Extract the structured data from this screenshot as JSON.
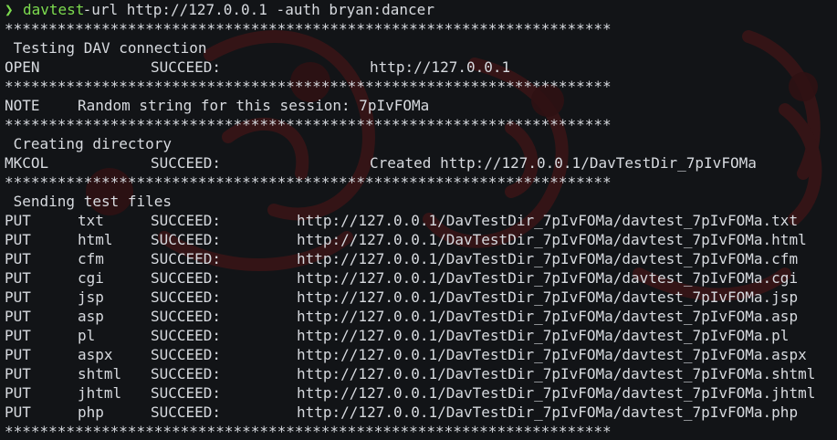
{
  "prompt": {
    "symbol": "❯",
    "command": "davtest",
    "args": " -url http://127.0.0.1 -auth bryan:dancer"
  },
  "separator": "*********************************************************************",
  "sections": {
    "connection_header": " Testing DAV connection",
    "connection": {
      "method": "OPEN",
      "status": "SUCCEED:",
      "url": "http://127.0.0.1"
    },
    "note": {
      "label": "NOTE",
      "text": "Random string for this session: 7pIvFOMa"
    },
    "directory_header": " Creating directory",
    "directory": {
      "method": "MKCOL",
      "status": "SUCCEED:",
      "url": "Created http://127.0.0.1/DavTestDir_7pIvFOMa"
    },
    "files_header": " Sending test files"
  },
  "put_rows": [
    {
      "method": "PUT",
      "ext": "txt",
      "status": "SUCCEED:",
      "url": "http://127.0.0.1/DavTestDir_7pIvFOMa/davtest_7pIvFOMa.txt"
    },
    {
      "method": "PUT",
      "ext": "html",
      "status": "SUCCEED:",
      "url": "http://127.0.0.1/DavTestDir_7pIvFOMa/davtest_7pIvFOMa.html"
    },
    {
      "method": "PUT",
      "ext": "cfm",
      "status": "SUCCEED:",
      "url": "http://127.0.0.1/DavTestDir_7pIvFOMa/davtest_7pIvFOMa.cfm"
    },
    {
      "method": "PUT",
      "ext": "cgi",
      "status": "SUCCEED:",
      "url": "http://127.0.0.1/DavTestDir_7pIvFOMa/davtest_7pIvFOMa.cgi"
    },
    {
      "method": "PUT",
      "ext": "jsp",
      "status": "SUCCEED:",
      "url": "http://127.0.0.1/DavTestDir_7pIvFOMa/davtest_7pIvFOMa.jsp"
    },
    {
      "method": "PUT",
      "ext": "asp",
      "status": "SUCCEED:",
      "url": "http://127.0.0.1/DavTestDir_7pIvFOMa/davtest_7pIvFOMa.asp"
    },
    {
      "method": "PUT",
      "ext": "pl",
      "status": "SUCCEED:",
      "url": "http://127.0.0.1/DavTestDir_7pIvFOMa/davtest_7pIvFOMa.pl"
    },
    {
      "method": "PUT",
      "ext": "aspx",
      "status": "SUCCEED:",
      "url": "http://127.0.0.1/DavTestDir_7pIvFOMa/davtest_7pIvFOMa.aspx"
    },
    {
      "method": "PUT",
      "ext": "shtml",
      "status": "SUCCEED:",
      "url": "http://127.0.0.1/DavTestDir_7pIvFOMa/davtest_7pIvFOMa.shtml"
    },
    {
      "method": "PUT",
      "ext": "jhtml",
      "status": "SUCCEED:",
      "url": "http://127.0.0.1/DavTestDir_7pIvFOMa/davtest_7pIvFOMa.jhtml"
    },
    {
      "method": "PUT",
      "ext": "php",
      "status": "SUCCEED:",
      "url": "http://127.0.0.1/DavTestDir_7pIvFOMa/davtest_7pIvFOMa.php"
    }
  ],
  "colors": {
    "background": "#121417",
    "text": "#d7dadf",
    "prompt_green": "#7ddc4f",
    "wallpaper_red": "#3a1416"
  }
}
